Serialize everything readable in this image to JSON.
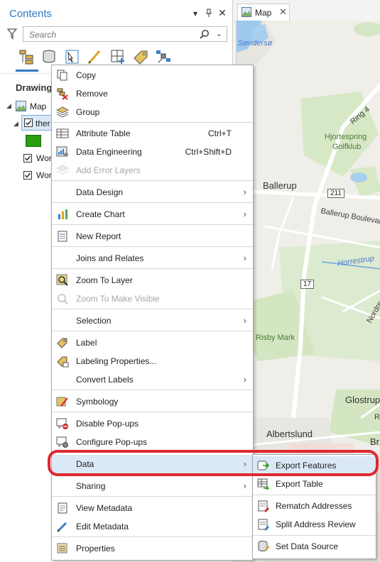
{
  "contents": {
    "title": "Contents",
    "search_placeholder": "Search",
    "section_label": "Drawing",
    "tree": {
      "map": "Map",
      "layer1": "ther",
      "layer2": "Wor",
      "layer3": "Wor"
    }
  },
  "map": {
    "tab_label": "Map",
    "labels": {
      "lake": "Søndersø",
      "ring": "Ring 4",
      "golf1": "Hjortespring",
      "golf2": "Golfklub",
      "ballerup": "Ballerup",
      "r211": "211",
      "blvd": "Ballerup Boulevar",
      "river": "Horrestrup",
      "r17": "17",
      "nordre": "Nordre",
      "risby": "Risby Mark",
      "glostrup": "Glostrup",
      "albertslund": "Albertslund",
      "bro": "Brø",
      "r": "R"
    }
  },
  "context_menu": {
    "items": [
      {
        "label": "Copy"
      },
      {
        "label": "Remove"
      },
      {
        "label": "Group"
      },
      {
        "label": "Attribute Table",
        "shortcut": "Ctrl+T"
      },
      {
        "label": "Data Engineering",
        "shortcut": "Ctrl+Shift+D"
      },
      {
        "label": "Add Error Layers"
      },
      {
        "label": "Data Design"
      },
      {
        "label": "Create Chart"
      },
      {
        "label": "New Report"
      },
      {
        "label": "Joins and Relates"
      },
      {
        "label": "Zoom To Layer"
      },
      {
        "label": "Zoom To Make Visible"
      },
      {
        "label": "Selection"
      },
      {
        "label": "Label"
      },
      {
        "label": "Labeling Properties..."
      },
      {
        "label": "Convert Labels"
      },
      {
        "label": "Symbology"
      },
      {
        "label": "Disable Pop-ups"
      },
      {
        "label": "Configure Pop-ups"
      },
      {
        "label": "Data"
      },
      {
        "label": "Sharing"
      },
      {
        "label": "View Metadata"
      },
      {
        "label": "Edit Metadata"
      },
      {
        "label": "Properties"
      }
    ],
    "submenu_arrow": "›"
  },
  "data_submenu": {
    "items": [
      {
        "label": "Export Features"
      },
      {
        "label": "Export Table"
      },
      {
        "label": "Rematch Addresses"
      },
      {
        "label": "Split Address Review"
      },
      {
        "label": "Set Data Source"
      }
    ]
  },
  "colors": {
    "accent": "#2f7bc4",
    "highlight_ring": "#e0272f",
    "hover": "#dbe8f7"
  }
}
